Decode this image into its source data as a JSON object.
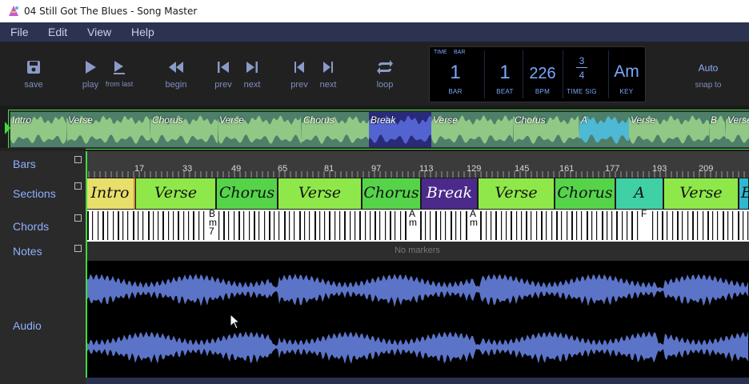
{
  "window": {
    "title": "04 Still Got The Blues - Song Master"
  },
  "menu": [
    "File",
    "Edit",
    "View",
    "Help"
  ],
  "toolbar": {
    "save": "save",
    "play": "play",
    "from_last": "from last",
    "begin": "begin",
    "prev": "prev",
    "next": "next",
    "prev2": "prev",
    "next2": "next",
    "loop": "loop",
    "snap_value": "Auto",
    "snap_label": "snap to"
  },
  "display": {
    "time_tab": "TIME",
    "bar_tab": "BAR",
    "bar_value": "1",
    "bar_label": "BAR",
    "beat_value": "1",
    "beat_label": "BEAT",
    "bpm_value": "226",
    "bpm_label": "BPM",
    "timesig_top": "3",
    "timesig_bottom": "4",
    "timesig_label": "TIME SIG",
    "key_value": "Am",
    "key_label": "KEY"
  },
  "overview": [
    {
      "name": "Intro"
    },
    {
      "name": "Verse"
    },
    {
      "name": "Chorus"
    },
    {
      "name": "Verse"
    },
    {
      "name": "Chorus"
    },
    {
      "name": "Break"
    },
    {
      "name": "Verse"
    },
    {
      "name": "Chorus"
    },
    {
      "name": "A"
    },
    {
      "name": "Verse"
    },
    {
      "name": "B"
    },
    {
      "name": "Verse"
    }
  ],
  "track_labels": {
    "bars": "Bars",
    "sections": "Sections",
    "chords": "Chords",
    "notes": "Notes",
    "audio": "Audio"
  },
  "ruler": [
    "17",
    "33",
    "49",
    "65",
    "81",
    "97",
    "113",
    "129",
    "145",
    "161",
    "177",
    "193",
    "209"
  ],
  "sections": [
    {
      "name": "Intro"
    },
    {
      "name": "Verse"
    },
    {
      "name": "Chorus"
    },
    {
      "name": "Verse"
    },
    {
      "name": "Chorus"
    },
    {
      "name": "Break"
    },
    {
      "name": "Verse"
    },
    {
      "name": "Chorus"
    },
    {
      "name": "A"
    },
    {
      "name": "Verse"
    },
    {
      "name": "B"
    }
  ],
  "chord_labels": [
    {
      "top": "B",
      "mid": "m",
      "bot": "7"
    },
    {
      "top": "A",
      "mid": "m",
      "bot": ""
    },
    {
      "top": "A",
      "mid": "m",
      "bot": ""
    },
    {
      "top": "F",
      "mid": "",
      "bot": ""
    }
  ],
  "notes": {
    "empty_text": "No markers"
  },
  "colors": {
    "intro": "#e8de6a",
    "verse": "#8fe84a",
    "chorus": "#55d44a",
    "break": "#4b2a8a",
    "a": "#3fd0a6",
    "b": "#2fb8cf",
    "accent": "#3fdc3f",
    "waveform": "#5b74c8",
    "display_text": "#7aa8ff"
  }
}
